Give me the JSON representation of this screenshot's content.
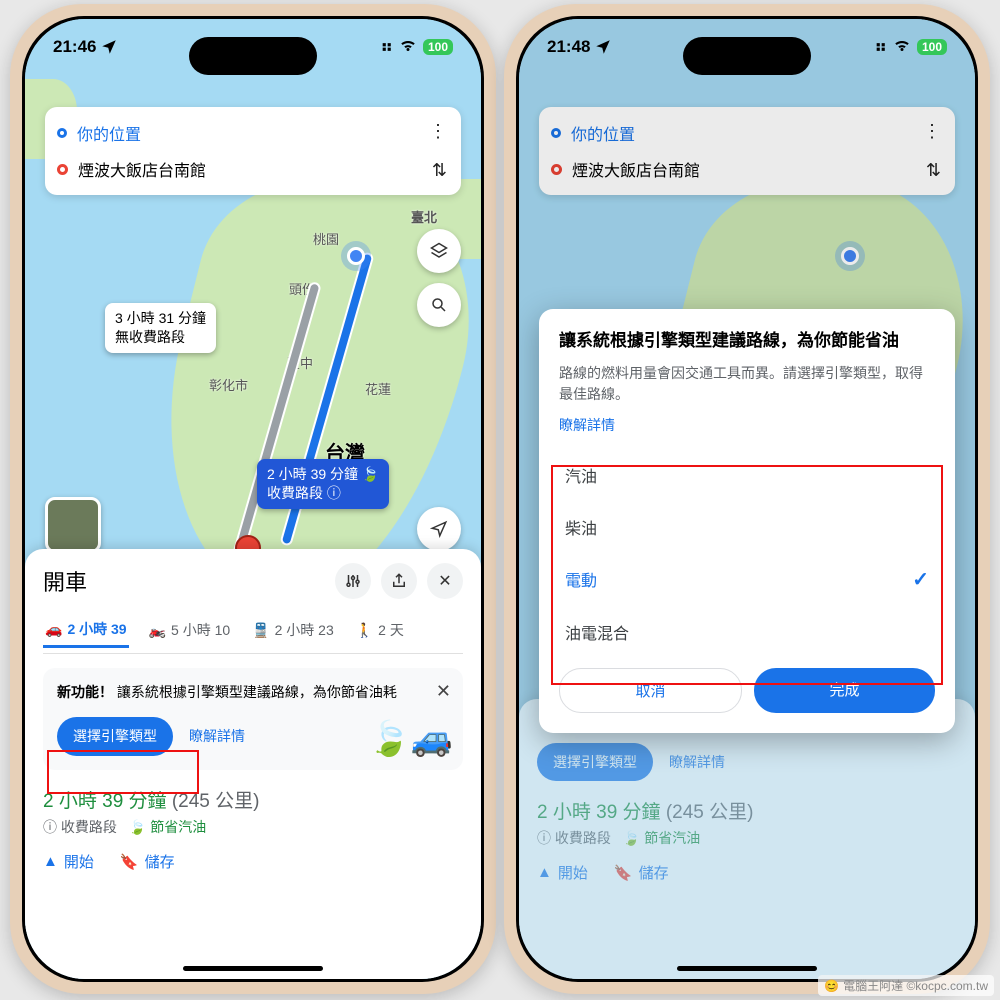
{
  "left": {
    "status": {
      "time": "21:46",
      "battery": "100"
    },
    "search": {
      "origin": "你的位置",
      "destination": "煙波大飯店台南館"
    },
    "map": {
      "country": "台灣",
      "labels": {
        "taipei": "臺北",
        "taoyuan": "桃園",
        "toufen": "頭份",
        "taichung": "臺中",
        "changhua": "彰化市",
        "hualien": "花蓮"
      },
      "alt_route": {
        "time": "3 小時 31 分鐘",
        "note": "無收費路段"
      },
      "main_route": {
        "time": "2 小時 39 分鐘",
        "note": "收費路段"
      }
    },
    "sheet": {
      "title": "開車",
      "tabs": {
        "drive": "2 小時 39",
        "motorcycle": "5 小時 10",
        "transit": "2 小時 23",
        "walk": "2 天"
      },
      "feature": {
        "badge": "新功能！",
        "text": "讓系統根據引擎類型建議路線，為你節省油耗",
        "select_btn": "選擇引擎類型",
        "learn": "瞭解詳情"
      },
      "summary": {
        "time": "2 小時 39 分鐘",
        "distance": "(245 公里)",
        "tolls": "收費路段",
        "eco": "節省汽油"
      },
      "actions": {
        "start": "開始",
        "save": "儲存"
      }
    }
  },
  "right": {
    "status": {
      "time": "21:48",
      "battery": "100"
    },
    "search": {
      "origin": "你的位置",
      "destination": "煙波大飯店台南館"
    },
    "dialog": {
      "title": "讓系統根據引擎類型建議路線，為你節能省油",
      "body": "路線的燃料用量會因交通工具而異。請選擇引擎類型，取得最佳路線。",
      "learn": "瞭解詳情",
      "options": [
        "汽油",
        "柴油",
        "電動",
        "油電混合"
      ],
      "selected_index": 2,
      "cancel": "取消",
      "done": "完成"
    },
    "sheet": {
      "select_btn": "選擇引擎類型",
      "learn": "瞭解詳情",
      "summary": {
        "time": "2 小時 39 分鐘",
        "distance": "(245 公里)",
        "tolls": "收費路段",
        "eco": "節省汽油"
      },
      "actions": {
        "start": "開始",
        "save": "儲存"
      }
    }
  },
  "watermark": "電腦王阿達 ©kocpc.com.tw"
}
